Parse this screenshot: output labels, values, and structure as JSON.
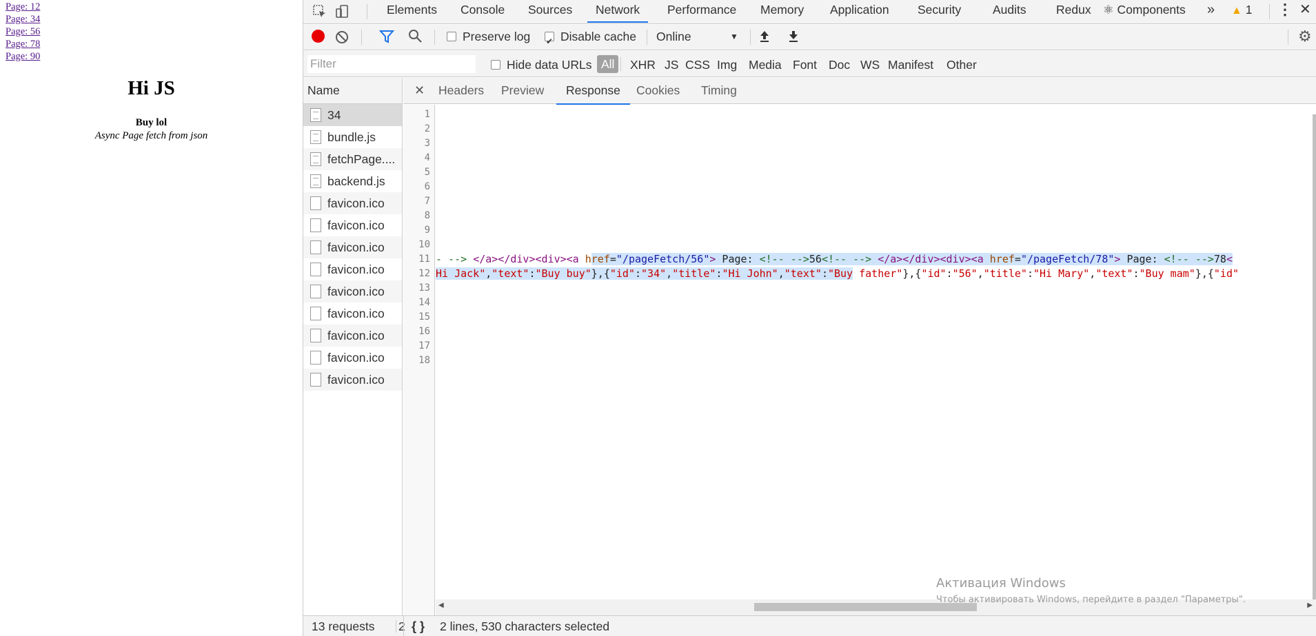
{
  "page": {
    "links": [
      "Page: 12",
      "Page: 34",
      "Page: 56",
      "Page: 78",
      "Page: 90"
    ],
    "title": "Hi JS",
    "subtitle": "Buy lol",
    "caption": "Async Page fetch from json"
  },
  "devtools": {
    "tabs": [
      "Elements",
      "Console",
      "Sources",
      "Network",
      "Performance",
      "Memory",
      "Application",
      "Security",
      "Audits",
      "Redux",
      "⚛ Components"
    ],
    "active_tab": "Network",
    "more_tabs": "»",
    "warning_count": "1",
    "toolbar": {
      "preserve_log": "Preserve log",
      "disable_cache": "Disable cache",
      "throttle": "Online"
    },
    "filter": {
      "placeholder": "Filter",
      "hide_data_urls": "Hide data URLs",
      "types": [
        "All",
        "XHR",
        "JS",
        "CSS",
        "Img",
        "Media",
        "Font",
        "Doc",
        "WS",
        "Manifest",
        "Other"
      ]
    },
    "requests": {
      "header": "Name",
      "items": [
        "34",
        "bundle.js",
        "fetchPage....",
        "backend.js",
        "favicon.ico",
        "favicon.ico",
        "favicon.ico",
        "favicon.ico",
        "favicon.ico",
        "favicon.ico",
        "favicon.ico",
        "favicon.ico",
        "favicon.ico"
      ]
    },
    "detail_tabs": [
      "Headers",
      "Preview",
      "Response",
      "Cookies",
      "Timing"
    ],
    "active_detail_tab": "Response",
    "response": {
      "line_numbers": [
        "1",
        "2",
        "3",
        "4",
        "5",
        "6",
        "7",
        "8",
        "9",
        "10",
        "11",
        "12",
        "13",
        "14",
        "15",
        "16",
        "17",
        "18"
      ],
      "line11": {
        "a": "- --> ",
        "b": "</a></div><div><a ",
        "c": "h",
        "d": "ref",
        "e": "=",
        "f": "\"/pageFetch/56\"",
        "g": ">",
        "h": " Page: ",
        "i": "<!-- -->",
        "j": "56",
        "k": "<!-- -->",
        "l": " ",
        "m": "</a></div><div><a ",
        "n": "href",
        "o": "=",
        "p": "\"/pageFetch/78\"",
        "q": ">",
        "r": " Page: ",
        "s": "<!-- -->",
        "t": "78",
        "u": "<"
      },
      "line12": {
        "a": "Hi Jack\"",
        "b": ",",
        "c": "\"text\"",
        "d": ":",
        "e": "\"Buy buy\"",
        "f": "},{",
        "g": "\"id\"",
        "h": ":",
        "i": "\"34\"",
        "j": ",",
        "k": "\"title\"",
        "l": ":",
        "m": "\"Hi John\"",
        "n": ",",
        "o": "\"text\"",
        "p": ":",
        "q": "\"Buy",
        "r": " father\"",
        "s": "},{",
        "t": "\"id\"",
        "u": ":",
        "v": "\"56\"",
        "w": ",",
        "x": "\"title\"",
        "y": ":",
        "z": "\"Hi Mary\"",
        "aa": ",",
        "ab": "\"text\"",
        "ac": ":",
        "ad": "\"Buy mam\"",
        "ae": "},{",
        "af": "\"id\""
      }
    },
    "status": {
      "requests": "13 requests",
      "transferred": "2",
      "pretty_print": "{ }",
      "selection": "2 lines, 530 characters selected"
    },
    "watermark": {
      "line1": "Активация Windows",
      "line2": "Чтобы активировать Windows, перейдите в раздел \"Параметры\"."
    }
  }
}
